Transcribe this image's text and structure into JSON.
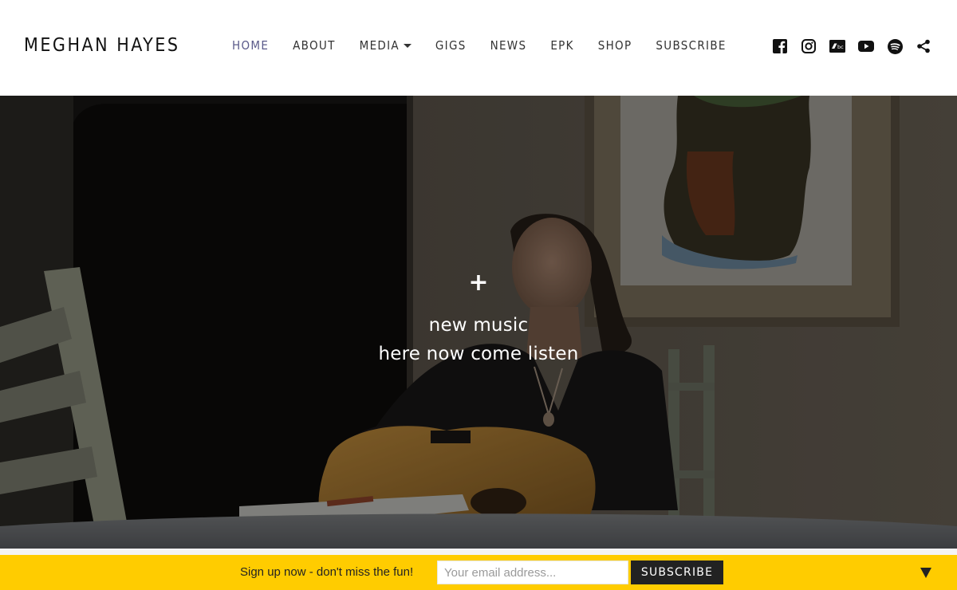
{
  "header": {
    "brand": "MEGHAN HAYES",
    "nav": [
      {
        "label": "HOME",
        "active": true
      },
      {
        "label": "ABOUT"
      },
      {
        "label": "MEDIA",
        "has_dropdown": true
      },
      {
        "label": "GIGS"
      },
      {
        "label": "NEWS"
      },
      {
        "label": "EPK"
      },
      {
        "label": "SHOP"
      },
      {
        "label": "SUBSCRIBE"
      }
    ],
    "socials": [
      "facebook-icon",
      "instagram-icon",
      "bandcamp-icon",
      "youtube-icon",
      "spotify-icon",
      "share-icon"
    ]
  },
  "hero": {
    "plus": "+",
    "line1": "new music",
    "line2": "here now come listen"
  },
  "signup": {
    "text": "Sign up now - don't miss the fun!",
    "placeholder": "Your email address...",
    "button": "SUBSCRIBE"
  },
  "colors": {
    "accent_nav_active": "#5a5a8a",
    "signup_bar": "#ffcc00",
    "button_dark": "#222222"
  }
}
